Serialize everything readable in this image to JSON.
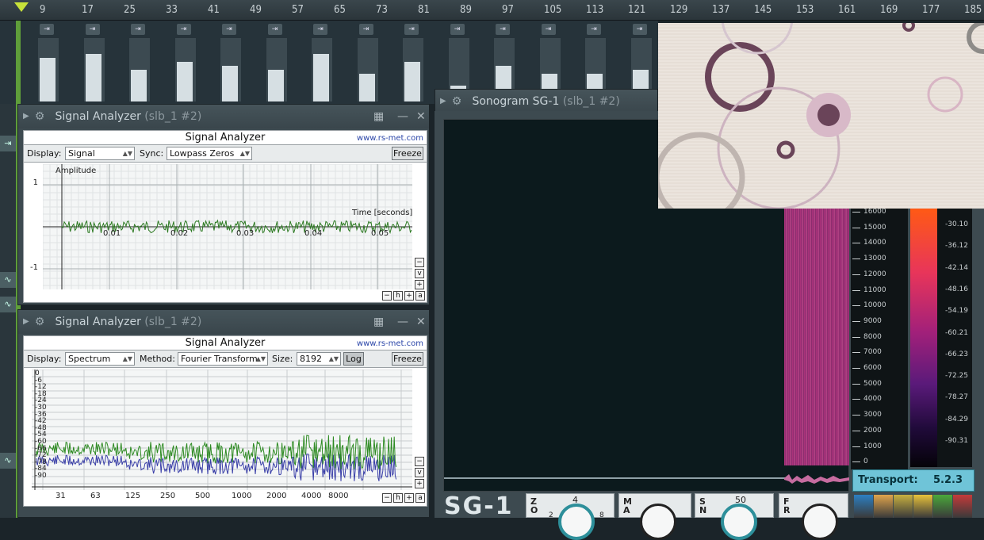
{
  "ruler": {
    "ticks": [
      "9",
      "17",
      "25",
      "33",
      "41",
      "49",
      "57",
      "65",
      "73",
      "81",
      "89",
      "97",
      "105",
      "113",
      "121",
      "129",
      "137",
      "145",
      "153",
      "161",
      "169",
      "177",
      "185"
    ]
  },
  "analyzer1": {
    "title": "Signal Analyzer",
    "instance": "(slb_1 #2)",
    "panel_title": "Signal Analyzer",
    "url": "www.rs-met.com",
    "display_label": "Display:",
    "display_value": "Signal",
    "sync_label": "Sync:",
    "sync_value": "Lowpass Zeros",
    "freeze": "Freeze",
    "y_title": "Amplitude",
    "x_title": "Time [seconds]",
    "y_ticks": [
      "1",
      "-1"
    ],
    "x_ticks": [
      "0.01",
      "0.02",
      "0.03",
      "0.04",
      "0.05"
    ],
    "zoom": [
      "−",
      "h",
      "+",
      "a",
      "−",
      "v",
      "+"
    ]
  },
  "analyzer2": {
    "title": "Signal Analyzer",
    "instance": "(slb_1 #2)",
    "panel_title": "Signal Analyzer",
    "url": "www.rs-met.com",
    "display_label": "Display:",
    "display_value": "Spectrum",
    "method_label": "Method:",
    "method_value": "Fourier Transform",
    "size_label": "Size:",
    "size_value": "8192",
    "log": "Log",
    "freeze": "Freeze",
    "y_ticks": [
      "0",
      "-6",
      "-12",
      "-18",
      "-24",
      "-30",
      "-36",
      "-42",
      "-48",
      "-54",
      "-60",
      "-66",
      "-72",
      "-78",
      "-84",
      "-90"
    ],
    "x_ticks": [
      "31",
      "63",
      "125",
      "250",
      "500",
      "1000",
      "2000",
      "4000",
      "8000"
    ]
  },
  "sonogram": {
    "title": "Sonogram SG-1",
    "instance": "(slb_1 #2)",
    "freq_labels": [
      "16000",
      "15000",
      "14000",
      "13000",
      "12000",
      "11000",
      "10000",
      "9000",
      "8000",
      "7000",
      "6000",
      "5000",
      "4000",
      "3000",
      "2000",
      "1000",
      "0"
    ],
    "db_labels": [
      "-30.10",
      "-36.12",
      "-42.14",
      "-48.16",
      "-54.19",
      "-60.21",
      "-66.23",
      "-72.25",
      "-78.27",
      "-84.29",
      "-90.31"
    ],
    "transport_label": "Transport:",
    "transport_value": "5.2.3",
    "brand": "SG-1",
    "knob_labels": [
      {
        "letters": "Z\nO",
        "value": "4",
        "sub": "2",
        "sub2": "8"
      },
      {
        "letters": "M\nA",
        "value": "",
        "sub": "",
        "sub2": ""
      },
      {
        "letters": "S\nN",
        "value": "50",
        "sub": "",
        "sub2": ""
      },
      {
        "letters": "F\nR",
        "value": "",
        "sub": "",
        "sub2": ""
      }
    ],
    "swatches": [
      "#2c7fc2",
      "#e0a44c",
      "#c8b040",
      "#e8c23a",
      "#4aa83a",
      "#c43a3a"
    ]
  },
  "overlay": {
    "accent": "#6b4a5e"
  }
}
